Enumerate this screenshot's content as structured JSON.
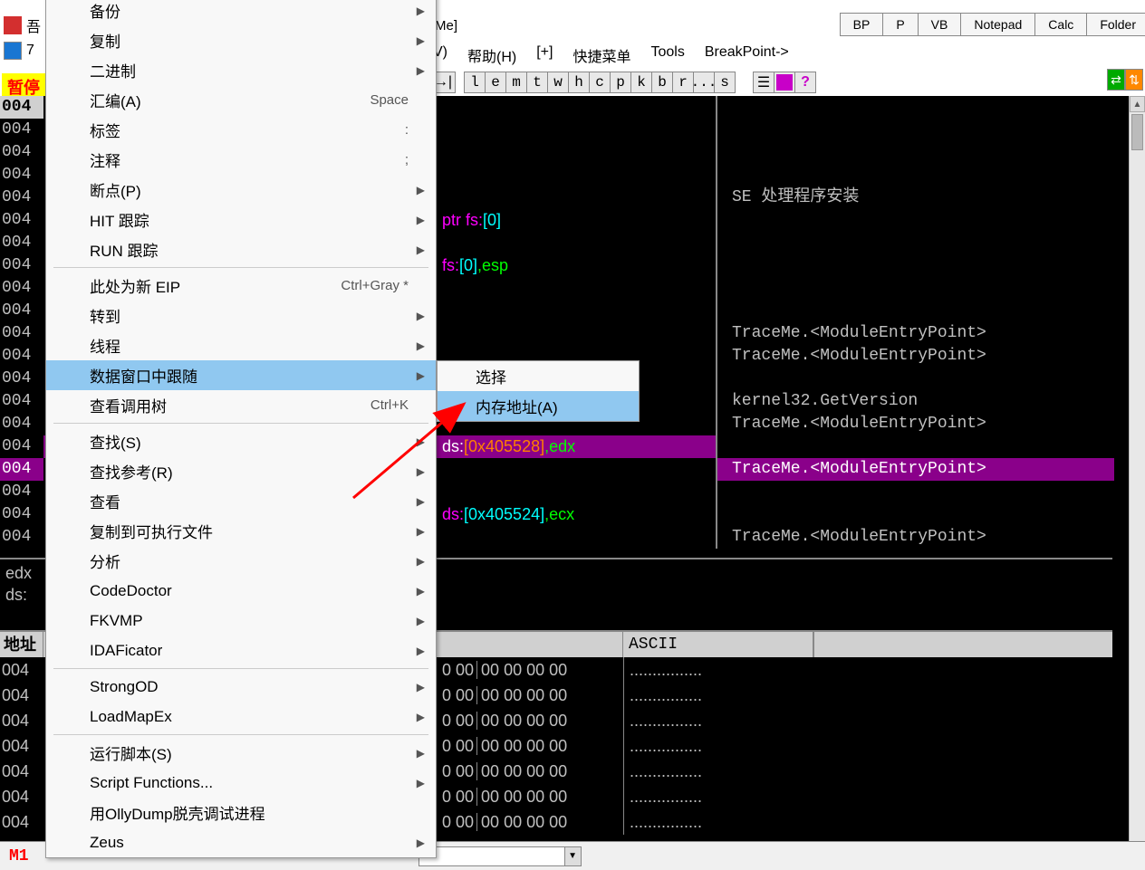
{
  "title_fragment": "Me]",
  "topright_tabs": [
    "BP",
    "P",
    "VB",
    "Notepad",
    "Calc",
    "Folder"
  ],
  "top_icon_chars": [
    "吾",
    "7"
  ],
  "menubar": [
    "V)",
    "帮助(H)",
    "[+]",
    "快捷菜单",
    "Tools",
    "BreakPoint->"
  ],
  "toolbar_letters": [
    "l",
    "e",
    "m",
    "t",
    "w",
    "h",
    "c",
    "p",
    "k",
    "b",
    "r",
    "...",
    "s"
  ],
  "pause_text": "暂停",
  "addresses": [
    "004",
    "004",
    "004",
    "004",
    "004",
    "004",
    "004",
    "004",
    "004",
    "004",
    "004",
    "004",
    "004",
    "004",
    "004",
    "004",
    "004",
    "004",
    "004",
    "004"
  ],
  "disasm": {
    "line5": {
      "a": "ptr fs:",
      "b": "[0]"
    },
    "line7": {
      "a": "fs:",
      "b": "[0]",
      "c": ",esp"
    },
    "line16": {
      "a": "ds:",
      "b": "[0x405528]",
      "c": ",edx"
    },
    "line19": {
      "a": "ds:",
      "b": "[0x405524]",
      "c": ",ecx"
    }
  },
  "comments": {
    "se": "SE 处理程序安装",
    "trace": "TraceMe.<ModuleEntryPoint>",
    "getver": "kernel32.GetVersion"
  },
  "reg_pane": {
    "l1": "edx",
    "l2": "ds:",
    "close": ")"
  },
  "dump_header": {
    "addr": "地址",
    "ascii": "ASCII"
  },
  "dump_addrs": [
    "004",
    "004",
    "004",
    "004",
    "004",
    "004",
    "004"
  ],
  "dump_hex_frag": "0 00",
  "dump_hex_block": "00 00 00 00",
  "dump_ascii": "................",
  "status_m1": "M1",
  "context_menu": [
    {
      "label": "备份",
      "arrow": true
    },
    {
      "label": "复制",
      "arrow": true
    },
    {
      "label": "二进制",
      "arrow": true
    },
    {
      "label": "汇编(A)",
      "shortcut": "Space"
    },
    {
      "label": "标签",
      "shortcut": ":"
    },
    {
      "label": "注释",
      "shortcut": ";"
    },
    {
      "label": "断点(P)",
      "arrow": true
    },
    {
      "label": "HIT 跟踪",
      "arrow": true
    },
    {
      "label": "RUN 跟踪",
      "arrow": true
    },
    {
      "sep": true
    },
    {
      "label": "此处为新 EIP",
      "shortcut": "Ctrl+Gray *"
    },
    {
      "label": "转到",
      "arrow": true
    },
    {
      "label": "线程",
      "arrow": true
    },
    {
      "label": "数据窗口中跟随",
      "arrow": true,
      "hl": true
    },
    {
      "label": "查看调用树",
      "shortcut": "Ctrl+K"
    },
    {
      "sep": true
    },
    {
      "label": "查找(S)",
      "arrow": true
    },
    {
      "label": "查找参考(R)",
      "arrow": true
    },
    {
      "label": "查看",
      "arrow": true
    },
    {
      "label": "复制到可执行文件",
      "arrow": true
    },
    {
      "label": "分析",
      "arrow": true
    },
    {
      "label": "CodeDoctor",
      "arrow": true
    },
    {
      "label": "FKVMP",
      "arrow": true
    },
    {
      "label": "IDAFicator",
      "arrow": true
    },
    {
      "sep": true
    },
    {
      "label": "StrongOD",
      "arrow": true
    },
    {
      "label": "LoadMapEx",
      "arrow": true
    },
    {
      "sep": true
    },
    {
      "label": "运行脚本(S)",
      "arrow": true
    },
    {
      "label": "Script Functions...",
      "arrow": true
    },
    {
      "label": "用OllyDump脱壳调试进程"
    },
    {
      "label": "Zeus",
      "arrow": true
    }
  ],
  "submenu": [
    {
      "label": "选择"
    },
    {
      "label": "内存地址(A)",
      "hl": true
    }
  ]
}
